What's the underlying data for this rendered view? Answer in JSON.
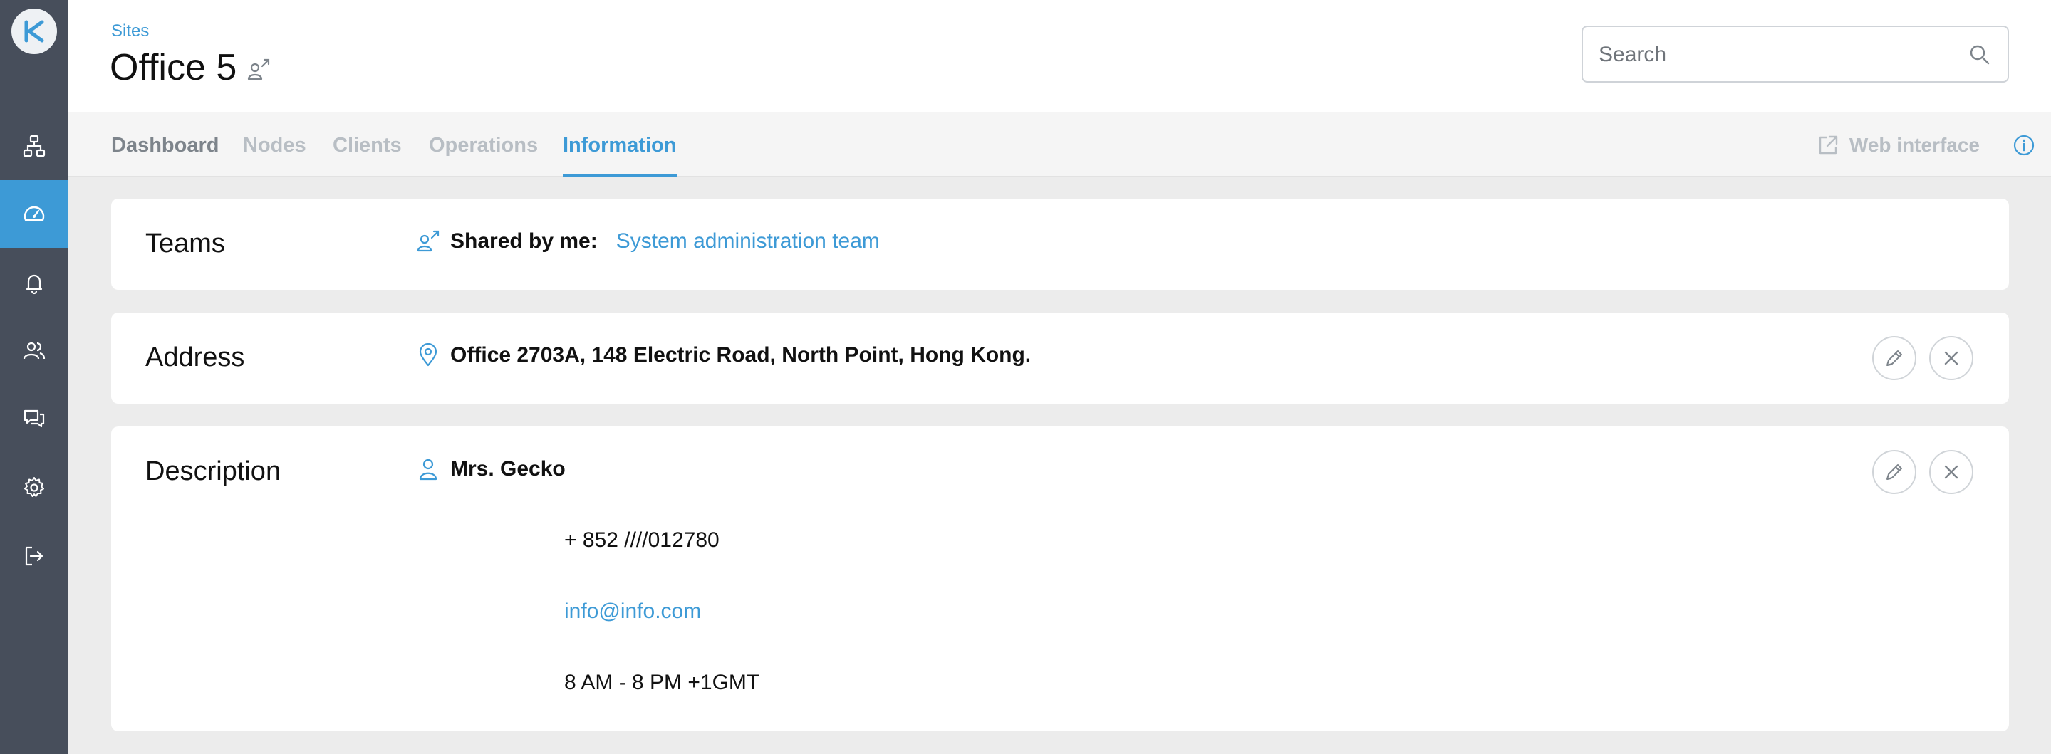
{
  "sidebar": {
    "logo_letter": "K",
    "items": [
      {
        "icon": "network-icon"
      },
      {
        "icon": "dashboard-gauge-icon",
        "active": true
      },
      {
        "icon": "bell-icon"
      },
      {
        "icon": "users-icon"
      },
      {
        "icon": "chat-icon"
      },
      {
        "icon": "gear-icon"
      },
      {
        "icon": "logout-icon"
      }
    ]
  },
  "header": {
    "breadcrumb": "Sites",
    "title": "Office 5",
    "search_placeholder": "Search"
  },
  "tabs": [
    {
      "label": "Dashboard",
      "state": "normal"
    },
    {
      "label": "Nodes",
      "state": "disabled"
    },
    {
      "label": "Clients",
      "state": "disabled"
    },
    {
      "label": "Operations",
      "state": "disabled"
    },
    {
      "label": "Information",
      "state": "active"
    }
  ],
  "tab_actions": {
    "web_interface": "Web interface"
  },
  "teams": {
    "title": "Teams",
    "shared_label": "Shared by me:",
    "team_name": "System administration team"
  },
  "address": {
    "title": "Address",
    "text": "Office 2703A, 148 Electric Road, North Point, Hong Kong."
  },
  "description": {
    "title": "Description",
    "name": "Mrs. Gecko",
    "phone": "+ 852 ////012780",
    "email": "info@info.com",
    "hours": "8 AM - 8 PM +1GMT"
  },
  "colors": {
    "accent": "#3d9ad6",
    "sidebar": "#474e5b",
    "background": "#ececec"
  }
}
